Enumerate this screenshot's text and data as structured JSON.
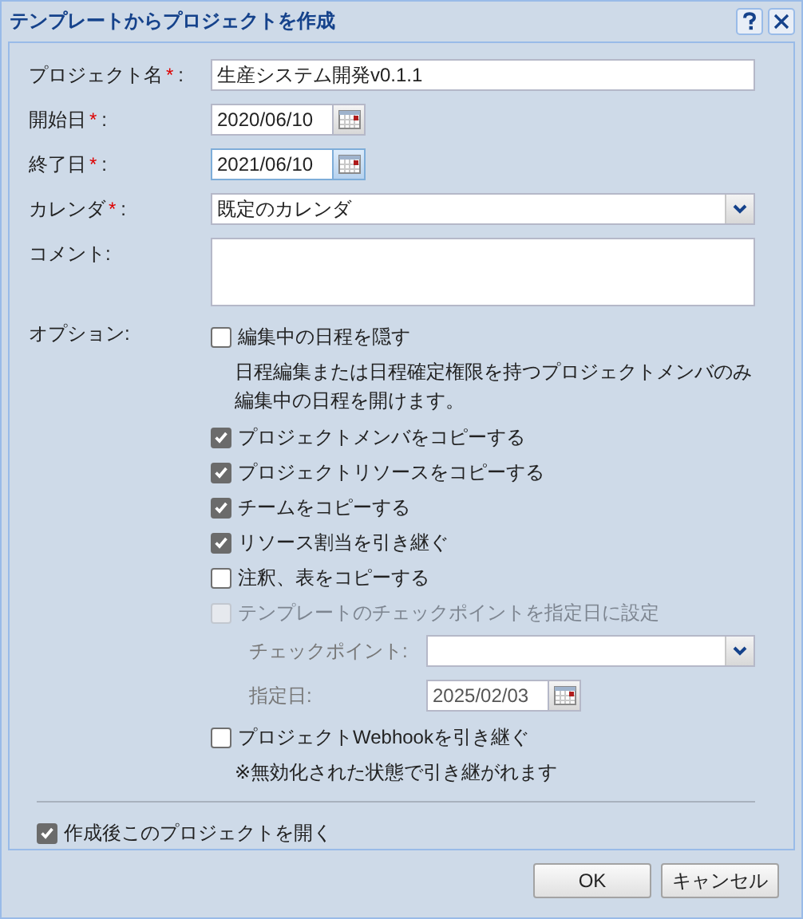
{
  "window": {
    "title": "テンプレートからプロジェクトを作成"
  },
  "fields": [
    {
      "kind": "text",
      "label": "プロジェクト名",
      "mark": "*",
      "colon": ":",
      "value": "生産システム開発v0.1.1",
      "focused": false
    },
    {
      "kind": "date",
      "label": "開始日",
      "mark": "*",
      "colon": ":",
      "value": "2020/06/10",
      "focused": false
    },
    {
      "kind": "date",
      "label": "終了日",
      "mark": "*",
      "colon": ":",
      "value": "2021/06/10",
      "focused": true
    },
    {
      "kind": "select",
      "label": "カレンダ",
      "mark": "*",
      "colon": ":",
      "value": "既定のカレンダ",
      "focused": false
    },
    {
      "kind": "textarea",
      "label": "コメント:",
      "focused": false
    }
  ],
  "options": {
    "label": "オプション:",
    "items": [
      {
        "kind": "checkbox",
        "label": "編集中の日程を隠す",
        "checked": false,
        "disabled": false,
        "note": "日程編集または日程確定権限を持つプロジェクトメンバのみ編集中の日程を開けます。"
      },
      {
        "kind": "checkbox",
        "label": "プロジェクトメンバをコピーする",
        "checked": true,
        "disabled": false
      },
      {
        "kind": "checkbox",
        "label": "プロジェクトリソースをコピーする",
        "checked": true,
        "disabled": false
      },
      {
        "kind": "checkbox",
        "label": "チームをコピーする",
        "checked": true,
        "disabled": false
      },
      {
        "kind": "checkbox",
        "label": "リソース割当を引き継ぐ",
        "checked": true,
        "disabled": false
      },
      {
        "kind": "checkbox",
        "label": "注釈、表をコピーする",
        "checked": false,
        "disabled": false
      },
      {
        "kind": "checkbox",
        "label": "テンプレートのチェックポイントを指定日に設定",
        "checked": false,
        "disabled": true
      },
      {
        "kind": "subselect",
        "label": "チェックポイント:",
        "disabled": true
      },
      {
        "kind": "subdate",
        "label": "指定日:",
        "value": "2025/02/03",
        "disabled": true
      },
      {
        "kind": "checkbox",
        "label": "プロジェクトWebhookを引き継ぐ",
        "checked": false,
        "disabled": false,
        "note": "※無効化された状態で引き継がれます"
      }
    ]
  },
  "open_after": {
    "label": "作成後このプロジェクトを開く",
    "checked": true
  },
  "buttons": [
    "OK",
    "キャンセル"
  ]
}
